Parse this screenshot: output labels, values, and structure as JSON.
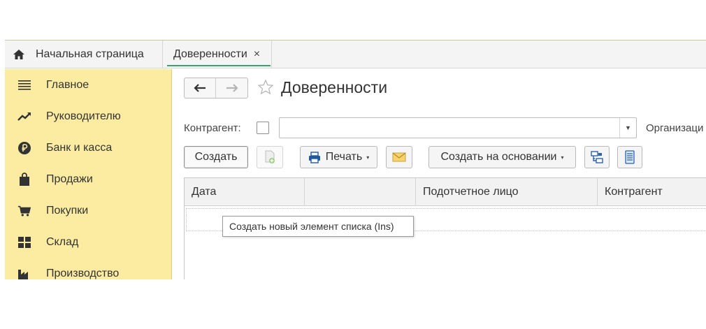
{
  "tabs": {
    "home_label": "Начальная страница",
    "doc_label": "Доверенности",
    "close_glyph": "×"
  },
  "sidebar": {
    "items": [
      {
        "label": "Главное",
        "icon": "menu-lines-icon"
      },
      {
        "label": "Руководителю",
        "icon": "trend-up-icon"
      },
      {
        "label": "Банк и касса",
        "icon": "ruble-coin-icon"
      },
      {
        "label": "Продажи",
        "icon": "shopping-bag-icon"
      },
      {
        "label": "Покупки",
        "icon": "cart-icon"
      },
      {
        "label": "Склад",
        "icon": "warehouse-grid-icon"
      },
      {
        "label": "Производство",
        "icon": "factory-icon"
      }
    ]
  },
  "page": {
    "title": "Доверенности",
    "back_glyph": "🡐",
    "forward_glyph": "🡒"
  },
  "filter": {
    "contractor_label": "Контрагент:",
    "contractor_value": "",
    "organization_label": "Организаци"
  },
  "toolbar": {
    "create_label": "Создать",
    "print_label": "Печать",
    "create_based_label": "Создать на основании",
    "dropdown_glyph": "▾"
  },
  "table": {
    "columns": [
      "Дата",
      "",
      "Подотчетное лицо",
      "Контрагент"
    ]
  },
  "tooltip": {
    "text": "Создать новый элемент списка (Ins)"
  },
  "colors": {
    "sidebar_bg": "#fbeca1",
    "active_tab_underline": "#3aa36b"
  }
}
